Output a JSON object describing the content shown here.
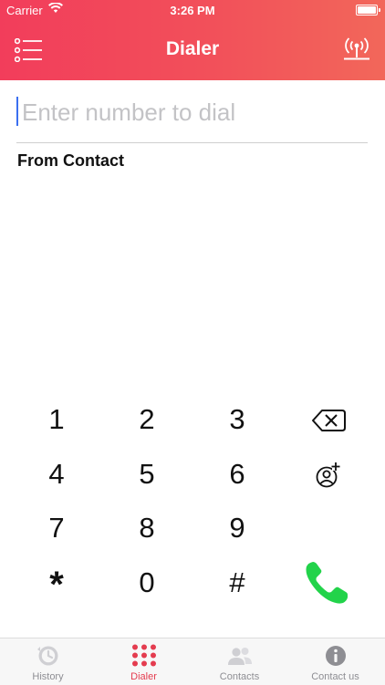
{
  "status_bar": {
    "carrier": "Carrier",
    "time": "3:26 PM"
  },
  "header": {
    "title": "Dialer",
    "menu_icon": "list-menu-icon",
    "signal_icon": "broadcast-tower-icon"
  },
  "dial_input": {
    "value": "",
    "placeholder": "Enter number to dial"
  },
  "from_contact_label": "From Contact",
  "keypad": {
    "rows": [
      [
        "1",
        "2",
        "3"
      ],
      [
        "4",
        "5",
        "6"
      ],
      [
        "7",
        "8",
        "9"
      ],
      [
        "*",
        "0",
        "#"
      ]
    ]
  },
  "tabs": [
    {
      "label": "History",
      "icon": "history-clock-icon"
    },
    {
      "label": "Dialer",
      "icon": "keypad-dots-icon",
      "active": true
    },
    {
      "label": "Contacts",
      "icon": "contacts-people-icon"
    },
    {
      "label": "Contact us",
      "icon": "info-icon"
    }
  ],
  "colors": {
    "header_start": "#f23d5b",
    "header_end": "#f2675a",
    "call_green": "#22d34a",
    "tab_active": "#e43c4f",
    "tab_inactive": "#8e8e93",
    "caret": "#3b6ff0"
  }
}
